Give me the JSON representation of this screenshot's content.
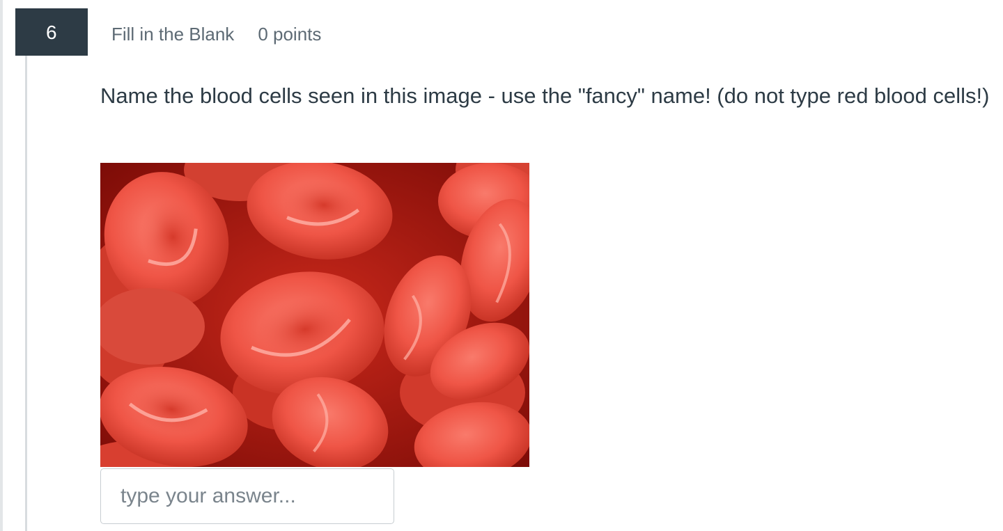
{
  "question": {
    "number": "6",
    "type": "Fill in the Blank",
    "points": "0 points",
    "text": "Name the blood cells seen in this image - use the \"fancy\" name!  (do not type red blood cells!)"
  },
  "image": {
    "subject": "red blood cells micrograph",
    "colors": {
      "cell": "#ef5a4c",
      "highlight": "#ff9b8e",
      "shadow": "#b51b10",
      "background": "#8b0f0a"
    }
  },
  "answer": {
    "value": "",
    "placeholder": "type your answer..."
  }
}
